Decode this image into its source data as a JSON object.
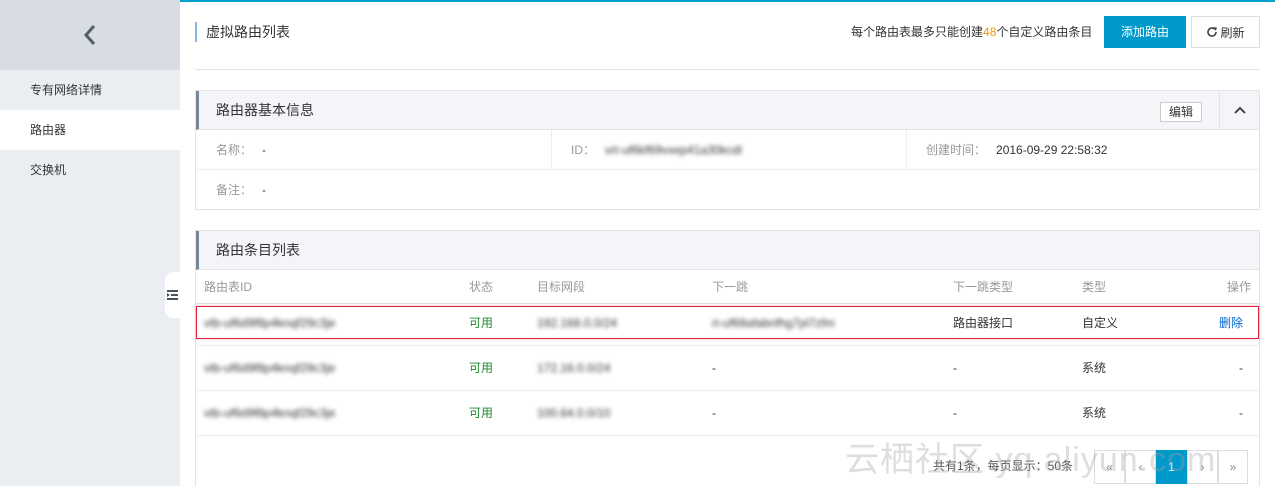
{
  "sidebar": {
    "back_icon": "chevron-left-icon",
    "items": [
      {
        "label": "专有网络详情",
        "active": false
      },
      {
        "label": "路由器",
        "active": true
      },
      {
        "label": "交换机",
        "active": false
      }
    ],
    "collapse_icon": "menu-collapse-icon"
  },
  "header": {
    "title": "虚拟路由列表",
    "quota_prefix": "每个路由表最多只能创建",
    "quota_count": "48",
    "quota_suffix": "个自定义路由条目",
    "add_button": "添加路由",
    "refresh_button": "刷新",
    "refresh_icon": "refresh-icon"
  },
  "basic_info": {
    "title": "路由器基本信息",
    "edit_button": "编辑",
    "collapse_icon": "chevron-up-icon",
    "name_label": "名称：",
    "name_value": "-",
    "id_label": "ID：",
    "id_value": "vrt-uf6kf69vxep41a30kcdl",
    "created_label": "创建时间：",
    "created_value": "2016-09-29 22:58:32",
    "remark_label": "备注：",
    "remark_value": "-"
  },
  "route_table": {
    "title": "路由条目列表",
    "columns": [
      "路由表ID",
      "状态",
      "目标网段",
      "下一跳",
      "下一跳类型",
      "类型",
      "操作"
    ],
    "rows": [
      {
        "id": "vtb-uf6d9f8p4knqf29c3je",
        "status": "可用",
        "cidr": "192.168.0.0/24",
        "next_hop": "ri-uf68afabnfhg7pl7zfm",
        "next_hop_type": "路由器接口",
        "type": "自定义",
        "action": "删除"
      },
      {
        "id": "vtb-uf6d9f8p4knqf29c3je",
        "status": "可用",
        "cidr": "172.16.0.0/24",
        "next_hop": "-",
        "next_hop_type": "-",
        "type": "系统",
        "action": "-"
      },
      {
        "id": "vtb-uf6d9f8p4knqf29c3je",
        "status": "可用",
        "cidr": "100.64.0.0/10",
        "next_hop": "-",
        "next_hop_type": "-",
        "type": "系统",
        "action": "-"
      }
    ]
  },
  "pagination": {
    "summary": "共有1条，每页显示：50条",
    "first": "«",
    "prev": "‹",
    "current": "1",
    "next": "›",
    "last": "»"
  },
  "watermark": "云栖社区 yq.aliyun.com",
  "colors": {
    "accent": "#0099cc",
    "quota_highlight": "#f39800",
    "status_ok": "#1e8a2e",
    "highlight_border": "#d9263c",
    "link": "#0066cc"
  }
}
